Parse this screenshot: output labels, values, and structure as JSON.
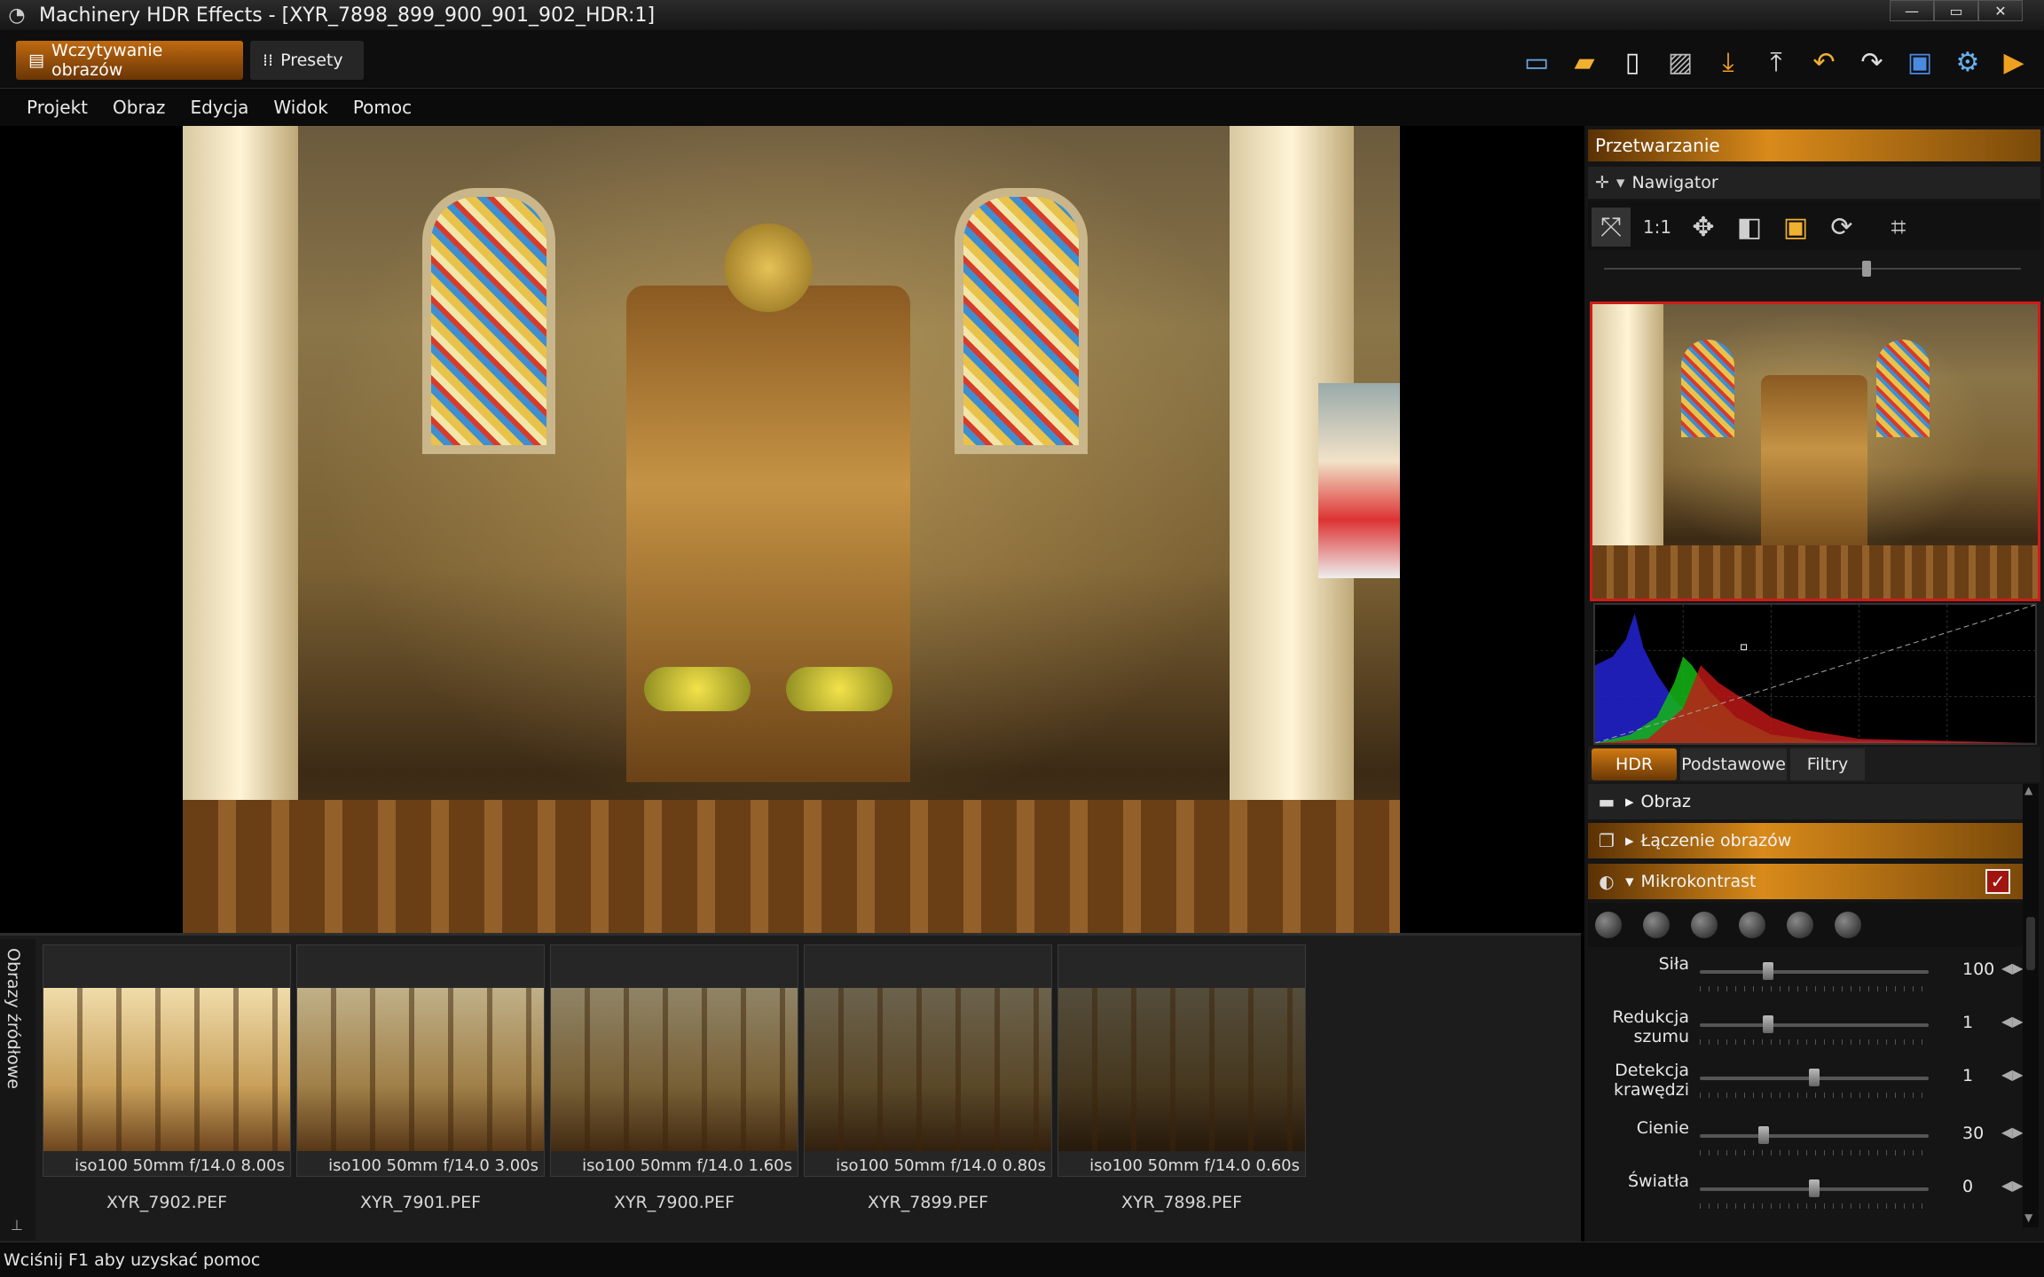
{
  "window": {
    "title": "Machinery HDR Effects - [XYR_7898_899_900_901_902_HDR:1]",
    "controls": {
      "minimize": "—",
      "maximize": "▭",
      "close": "✕"
    }
  },
  "toolbar": {
    "tab_loading": "Wczytywanie obrazów",
    "tab_presets": "Presety",
    "icons": [
      "image-icon",
      "folder-icon",
      "document-icon",
      "pattern-icon",
      "download-icon",
      "upload-icon",
      "undo-icon",
      "redo-icon",
      "save-icon",
      "settings-gear-icon",
      "play-icon"
    ]
  },
  "menu": [
    "Projekt",
    "Obraz",
    "Edycja",
    "Widok",
    "Pomoc"
  ],
  "panel": {
    "header": "Przetwarzanie",
    "navigator": {
      "title": "Nawigator",
      "one_to_one": "1:1",
      "zoom": 0.63
    },
    "tabs": [
      "HDR",
      "Podstawowe",
      "Filtry"
    ],
    "sections": {
      "obraz": "Obraz",
      "laczenie": "Łączenie obrazów",
      "mikro": "Mikrokontrast",
      "mikro_checked": "✓"
    },
    "params": [
      {
        "label": "Siła",
        "value": "100",
        "level": 0.3
      },
      {
        "label": "Redukcja szumu",
        "value": "1",
        "level": 0.3
      },
      {
        "label": "Detekcja krawędzi",
        "value": "1",
        "level": 0.5
      },
      {
        "label": "Cienie",
        "value": "30",
        "level": 0.28
      },
      {
        "label": "Światła",
        "value": "0",
        "level": 0.5
      }
    ],
    "arrows": "◀▶"
  },
  "filmstrip": {
    "side_label": "Obrazy źródłowe",
    "pin": "⊥",
    "items": [
      {
        "meta": "iso100  50mm  f/14.0  8.00s",
        "name": "XYR_7902.PEF",
        "brightness": 1.0
      },
      {
        "meta": "iso100  50mm  f/14.0  3.00s",
        "name": "XYR_7901.PEF",
        "brightness": 0.8
      },
      {
        "meta": "iso100  50mm  f/14.0  1.60s",
        "name": "XYR_7900.PEF",
        "brightness": 0.6
      },
      {
        "meta": "iso100  50mm  f/14.0  0.80s",
        "name": "XYR_7899.PEF",
        "brightness": 0.45
      },
      {
        "meta": "iso100  50mm  f/14.0  0.60s",
        "name": "XYR_7898.PEF",
        "brightness": 0.35
      }
    ]
  },
  "status": "Wciśnij F1 aby uzyskać pomoc"
}
